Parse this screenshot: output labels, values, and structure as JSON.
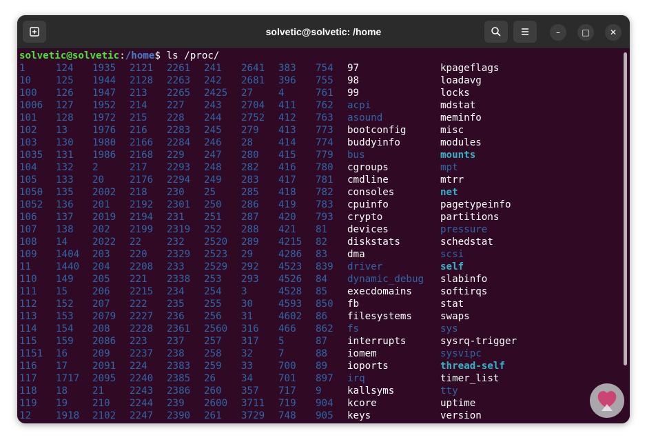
{
  "window": {
    "title": "solvetic@solvetic: /home",
    "new_tab_icon": "new-tab-icon",
    "search_icon": "search-icon",
    "menu_icon": "hamburger-menu-icon",
    "minimize_glyph": "–",
    "maximize_glyph": "□",
    "close_glyph": "✕"
  },
  "prompt": {
    "user_host": "solvetic@solvetic",
    "colon": ":",
    "path": "/home",
    "symbol": "$ ",
    "command": "ls /proc/"
  },
  "colors": {
    "terminal_bg": "#300a24",
    "number_dir": "#2f65a8",
    "bold_entry": "#34b3c8",
    "prompt_user": "#4ee039",
    "prompt_path": "#4a7cc9"
  },
  "listing": {
    "rows": [
      [
        "1",
        "124",
        "1935",
        "2121",
        "2261",
        "241",
        "2641",
        "383",
        "754",
        "97",
        "kpageflags"
      ],
      [
        "10",
        "125",
        "1944",
        "2128",
        "2263",
        "242",
        "2681",
        "396",
        "755",
        "98",
        "loadavg"
      ],
      [
        "100",
        "126",
        "1947",
        "213",
        "2265",
        "2425",
        "27",
        "4",
        "761",
        "99",
        "locks"
      ],
      [
        "1006",
        "127",
        "1952",
        "214",
        "227",
        "243",
        "2704",
        "411",
        "762",
        "acpi",
        "mdstat"
      ],
      [
        "101",
        "128",
        "1972",
        "215",
        "228",
        "244",
        "2752",
        "412",
        "763",
        "asound",
        "meminfo"
      ],
      [
        "102",
        "13",
        "1976",
        "216",
        "2283",
        "245",
        "279",
        "413",
        "773",
        "bootconfig",
        "misc"
      ],
      [
        "103",
        "130",
        "1980",
        "2166",
        "2284",
        "246",
        "28",
        "414",
        "774",
        "buddyinfo",
        "modules"
      ],
      [
        "1035",
        "131",
        "1986",
        "2168",
        "229",
        "247",
        "280",
        "415",
        "779",
        "bus",
        "mounts"
      ],
      [
        "104",
        "132",
        "2",
        "217",
        "2293",
        "248",
        "282",
        "416",
        "780",
        "cgroups",
        "mpt"
      ],
      [
        "105",
        "133",
        "20",
        "2176",
        "2294",
        "249",
        "283",
        "417",
        "781",
        "cmdline",
        "mtrr"
      ],
      [
        "1050",
        "135",
        "2002",
        "218",
        "230",
        "25",
        "285",
        "418",
        "782",
        "consoles",
        "net"
      ],
      [
        "1052",
        "136",
        "201",
        "2192",
        "2301",
        "250",
        "286",
        "419",
        "783",
        "cpuinfo",
        "pagetypeinfo"
      ],
      [
        "106",
        "137",
        "2019",
        "2194",
        "231",
        "251",
        "287",
        "420",
        "793",
        "crypto",
        "partitions"
      ],
      [
        "107",
        "138",
        "202",
        "2199",
        "2319",
        "252",
        "288",
        "421",
        "81",
        "devices",
        "pressure"
      ],
      [
        "108",
        "14",
        "2022",
        "22",
        "232",
        "2520",
        "289",
        "4215",
        "82",
        "diskstats",
        "schedstat"
      ],
      [
        "109",
        "1404",
        "203",
        "220",
        "2329",
        "2523",
        "29",
        "4286",
        "83",
        "dma",
        "scsi"
      ],
      [
        "11",
        "1440",
        "204",
        "2208",
        "233",
        "2529",
        "292",
        "4523",
        "839",
        "driver",
        "self"
      ],
      [
        "110",
        "149",
        "205",
        "221",
        "2338",
        "253",
        "293",
        "4526",
        "84",
        "dynamic_debug",
        "slabinfo"
      ],
      [
        "111",
        "15",
        "206",
        "2215",
        "234",
        "254",
        "3",
        "4528",
        "85",
        "execdomains",
        "softirqs"
      ],
      [
        "112",
        "152",
        "207",
        "222",
        "235",
        "255",
        "30",
        "4593",
        "850",
        "fb",
        "stat"
      ],
      [
        "113",
        "153",
        "2079",
        "2227",
        "236",
        "256",
        "31",
        "4602",
        "86",
        "filesystems",
        "swaps"
      ],
      [
        "114",
        "154",
        "208",
        "2228",
        "2361",
        "2560",
        "316",
        "466",
        "862",
        "fs",
        "sys"
      ],
      [
        "115",
        "159",
        "2086",
        "223",
        "237",
        "257",
        "317",
        "5",
        "87",
        "interrupts",
        "sysrq-trigger"
      ],
      [
        "1151",
        "16",
        "209",
        "2237",
        "238",
        "258",
        "32",
        "7",
        "88",
        "iomem",
        "sysvipc"
      ],
      [
        "116",
        "17",
        "2091",
        "224",
        "2383",
        "259",
        "33",
        "700",
        "89",
        "ioports",
        "thread-self"
      ],
      [
        "117",
        "1717",
        "2095",
        "2240",
        "2385",
        "26",
        "34",
        "701",
        "897",
        "irq",
        "timer_list"
      ],
      [
        "118",
        "18",
        "21",
        "2243",
        "2386",
        "260",
        "357",
        "717",
        "9",
        "kallsyms",
        "tty"
      ],
      [
        "119",
        "19",
        "210",
        "2244",
        "239",
        "2600",
        "3711",
        "719",
        "904",
        "kcore",
        "uptime"
      ],
      [
        "12",
        "1918",
        "2102",
        "2247",
        "2390",
        "261",
        "3729",
        "748",
        "905",
        "keys",
        "version"
      ]
    ],
    "dir_names": [
      "acpi",
      "asound",
      "bus",
      "driver",
      "dynamic_debug",
      "fs",
      "irq",
      "mpt",
      "pressure",
      "scsi",
      "sys",
      "sysvipc",
      "tty"
    ],
    "bold_names": [
      "mounts",
      "net",
      "self",
      "thread-self"
    ]
  }
}
